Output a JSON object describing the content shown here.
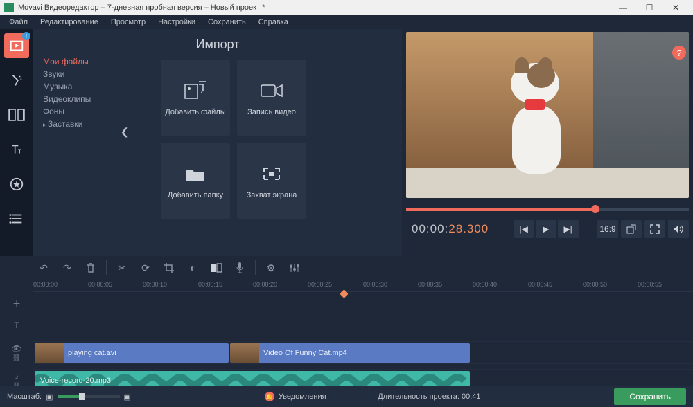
{
  "title": "Movavi Видеоредактор – 7-дневная пробная версия – Новый проект *",
  "menubar": [
    "Файл",
    "Редактирование",
    "Просмотр",
    "Настройки",
    "Сохранить",
    "Справка"
  ],
  "import": {
    "heading": "Импорт",
    "nav": [
      "Мои файлы",
      "Звуки",
      "Музыка",
      "Видеоклипы",
      "Фоны",
      "Заставки"
    ],
    "cards": [
      {
        "label": "Добавить файлы"
      },
      {
        "label": "Запись видео"
      },
      {
        "label": "Добавить папку"
      },
      {
        "label": "Захват экрана"
      }
    ]
  },
  "preview": {
    "timecode_gray": "00:00:",
    "timecode_orange": "28.300",
    "aspect": "16:9"
  },
  "timeline": {
    "ticks": [
      "00:00:00",
      "00:00:05",
      "00:00:10",
      "00:00:15",
      "00:00:20",
      "00:00:25",
      "00:00:30",
      "00:00:35",
      "00:00:40",
      "00:00:45",
      "00:00:50",
      "00:00:55"
    ],
    "clips": {
      "video1": "playing cat.avi",
      "video2": "Video Of Funny Cat.mp4",
      "audio1": "Voice-record-20.mp3"
    }
  },
  "bottom": {
    "zoom_label": "Масштаб:",
    "notif": "Уведомления",
    "duration_label": "Длительность проекта:",
    "duration_value": "00:41",
    "save": "Сохранить"
  }
}
